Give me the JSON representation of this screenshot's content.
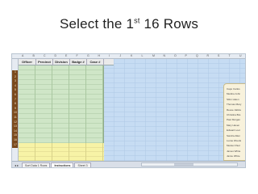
{
  "slide": {
    "title_prefix": "Select the 1",
    "title_sup": "st",
    "title_suffix": " 16 Rows"
  },
  "spreadsheet": {
    "columns": [
      "A",
      "B",
      "C",
      "D",
      "E",
      "F",
      "G",
      "H",
      "I",
      "J",
      "K",
      "L",
      "M",
      "N",
      "O",
      "P",
      "Q",
      "R",
      "S",
      "T",
      "U"
    ],
    "header_row": [
      "Officer",
      "Precinct",
      "Division",
      "Badge #",
      "Case #"
    ],
    "row_numbers": [
      "1",
      "2",
      "3",
      "4",
      "5",
      "6",
      "7",
      "8",
      "9",
      "10",
      "11",
      "12",
      "13",
      "14",
      "15",
      "16",
      "17"
    ],
    "officer_list": [
      "Capo Carlos",
      "Medina John",
      "Sifon Helen",
      "Thomas Mary",
      "Reese Jalicia",
      "Christina Bra",
      "Paul Morgan",
      "Mary Haven",
      "Edward Loot",
      "Sandra Allen",
      "Lucas Woods",
      "Meister Paul",
      "James White",
      "Jamie White"
    ],
    "sheet_tabs": [
      "Sort Data 1 Rows",
      "Instructions",
      "Sheet 3"
    ],
    "active_tab_index": 1,
    "tab_nav": "◂ ▸"
  },
  "colors": {
    "row_selection": "#7a4a1d",
    "data_green": "#cfe6c7",
    "data_yellow": "#f7f3a6",
    "sheet_blue": "#c6dcf3"
  }
}
